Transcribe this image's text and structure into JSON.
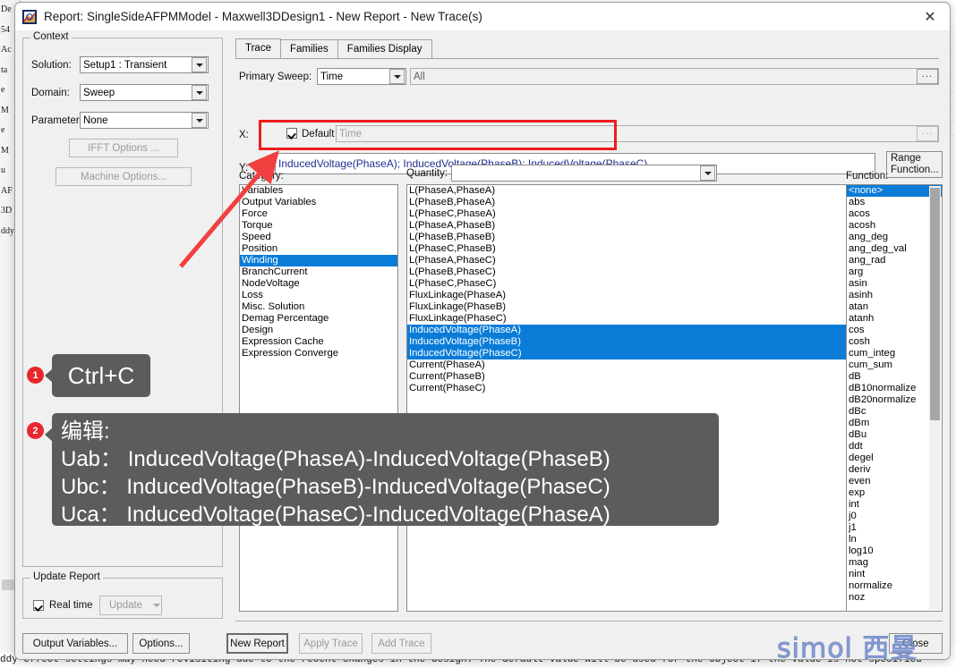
{
  "window": {
    "title": "Report: SingleSideAFPMModel - Maxwell3DDesign1 - New Report - New Trace(s)",
    "icon": "report-icon",
    "close_icon": "✕"
  },
  "context": {
    "group_title": "Context",
    "solution_label": "Solution:",
    "solution_value": "Setup1 : Transient",
    "domain_label": "Domain:",
    "domain_value": "Sweep",
    "parameter_label": "Parameter:",
    "parameter_value": "None",
    "ifft_button": "IFFT Options ...",
    "machine_button": "Machine Options..."
  },
  "update_report": {
    "group_title": "Update Report",
    "realtime_label": "Real time",
    "update_button": "Update"
  },
  "tabs": [
    {
      "label": "Trace",
      "active": true
    },
    {
      "label": "Families",
      "active": false
    },
    {
      "label": "Families Display",
      "active": false
    }
  ],
  "trace": {
    "primary_sweep_label": "Primary Sweep:",
    "primary_sweep_value": "Time",
    "primary_sweep_range": "All",
    "x_label": "X:",
    "x_default_label": "Default",
    "x_value": "Time",
    "y_label": "Y:",
    "y_value": "InducedVoltage(PhaseA); InducedVoltage(PhaseB); InducedVoltage(PhaseC)",
    "range_function_button": "Range\nFunction...",
    "ellipsis": "..."
  },
  "category": {
    "label": "Category:",
    "items": [
      {
        "label": "Variables",
        "selected": false
      },
      {
        "label": "Output Variables",
        "selected": false
      },
      {
        "label": "Force",
        "selected": false
      },
      {
        "label": "Torque",
        "selected": false
      },
      {
        "label": "Speed",
        "selected": false
      },
      {
        "label": "Position",
        "selected": false
      },
      {
        "label": "Winding",
        "selected": true
      },
      {
        "label": "BranchCurrent",
        "selected": false
      },
      {
        "label": "NodeVoltage",
        "selected": false
      },
      {
        "label": "Loss",
        "selected": false
      },
      {
        "label": "Misc. Solution",
        "selected": false
      },
      {
        "label": "Demag Percentage",
        "selected": false
      },
      {
        "label": "Design",
        "selected": false
      },
      {
        "label": "Expression Cache",
        "selected": false
      },
      {
        "label": "Expression Converge",
        "selected": false
      }
    ]
  },
  "quantity": {
    "label": "Quantity:",
    "filter_value": "",
    "items": [
      {
        "label": "L(PhaseA,PhaseA)",
        "selected": false
      },
      {
        "label": "L(PhaseB,PhaseA)",
        "selected": false
      },
      {
        "label": "L(PhaseC,PhaseA)",
        "selected": false
      },
      {
        "label": "L(PhaseA,PhaseB)",
        "selected": false
      },
      {
        "label": "L(PhaseB,PhaseB)",
        "selected": false
      },
      {
        "label": "L(PhaseC,PhaseB)",
        "selected": false
      },
      {
        "label": "L(PhaseA,PhaseC)",
        "selected": false
      },
      {
        "label": "L(PhaseB,PhaseC)",
        "selected": false
      },
      {
        "label": "L(PhaseC,PhaseC)",
        "selected": false
      },
      {
        "label": "FluxLinkage(PhaseA)",
        "selected": false
      },
      {
        "label": "FluxLinkage(PhaseB)",
        "selected": false
      },
      {
        "label": "FluxLinkage(PhaseC)",
        "selected": false
      },
      {
        "label": "InducedVoltage(PhaseA)",
        "selected": true
      },
      {
        "label": "InducedVoltage(PhaseB)",
        "selected": true
      },
      {
        "label": "InducedVoltage(PhaseC)",
        "selected": true
      },
      {
        "label": "Current(PhaseA)",
        "selected": false
      },
      {
        "label": "Current(PhaseB)",
        "selected": false
      },
      {
        "label": "Current(PhaseC)",
        "selected": false
      }
    ]
  },
  "function": {
    "label": "Function:",
    "items": [
      {
        "label": "<none>",
        "selected": true
      },
      {
        "label": "abs",
        "selected": false
      },
      {
        "label": "acos",
        "selected": false
      },
      {
        "label": "acosh",
        "selected": false
      },
      {
        "label": "ang_deg",
        "selected": false
      },
      {
        "label": "ang_deg_val",
        "selected": false
      },
      {
        "label": "ang_rad",
        "selected": false
      },
      {
        "label": "arg",
        "selected": false
      },
      {
        "label": "asin",
        "selected": false
      },
      {
        "label": "asinh",
        "selected": false
      },
      {
        "label": "atan",
        "selected": false
      },
      {
        "label": "atanh",
        "selected": false
      },
      {
        "label": "cos",
        "selected": false
      },
      {
        "label": "cosh",
        "selected": false
      },
      {
        "label": "cum_integ",
        "selected": false
      },
      {
        "label": "cum_sum",
        "selected": false
      },
      {
        "label": "dB",
        "selected": false
      },
      {
        "label": "dB10normalize",
        "selected": false
      },
      {
        "label": "dB20normalize",
        "selected": false
      },
      {
        "label": "dBc",
        "selected": false
      },
      {
        "label": "dBm",
        "selected": false
      },
      {
        "label": "dBu",
        "selected": false
      },
      {
        "label": "ddt",
        "selected": false
      },
      {
        "label": "degel",
        "selected": false
      },
      {
        "label": "deriv",
        "selected": false
      },
      {
        "label": "even",
        "selected": false
      },
      {
        "label": "exp",
        "selected": false
      },
      {
        "label": "int",
        "selected": false
      },
      {
        "label": "j0",
        "selected": false
      },
      {
        "label": "j1",
        "selected": false
      },
      {
        "label": "ln",
        "selected": false
      },
      {
        "label": "log10",
        "selected": false
      },
      {
        "label": "mag",
        "selected": false
      },
      {
        "label": "nint",
        "selected": false
      },
      {
        "label": "normalize",
        "selected": false
      },
      {
        "label": "noz",
        "selected": false
      }
    ]
  },
  "footer": {
    "output_variables_button": "Output Variables...",
    "options_button": "Options...",
    "new_report_button": "New Report",
    "apply_trace_button": "Apply Trace",
    "add_trace_button": "Add Trace",
    "close_button": "Close"
  },
  "annotations": {
    "marker1": "1",
    "marker2": "2",
    "callout1": "Ctrl+C",
    "callout2_title": "编辑:",
    "callout2_lines": [
      "Uab： InducedVoltage(PhaseA)-InducedVoltage(PhaseB)",
      "Ubc： InducedVoltage(PhaseB)-InducedVoltage(PhaseC)",
      "Uca： InducedVoltage(PhaseC)-InducedVoltage(PhaseA)"
    ],
    "highlight_color": "#ee1c1c",
    "arrow_color": "#f04040"
  },
  "background": {
    "status_text": "ddy effect settings may need revisiting due to the recent changes in the design.  The default value will be used for the object if the value is not specified",
    "left_fragments": [
      "De",
      "54",
      "Ac",
      "ta",
      "e",
      "M",
      "e",
      "M",
      "u",
      "",
      "",
      "",
      "",
      "",
      "",
      "",
      "",
      "",
      "",
      "",
      "",
      "",
      "",
      "",
      "",
      "",
      "",
      "",
      "",
      "AF",
      "3D",
      "ddy"
    ],
    "watermark": "simol 西曼"
  }
}
